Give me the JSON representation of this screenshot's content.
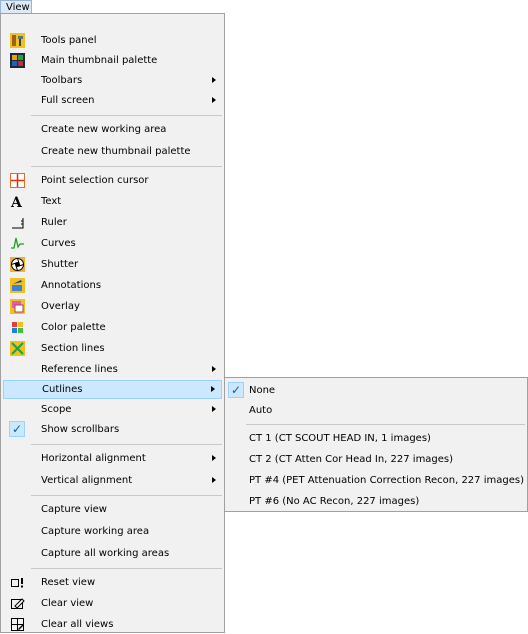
{
  "menubar": {
    "view_label": "View"
  },
  "menu": {
    "tools_panel": "Tools panel",
    "main_thumbnail_palette": "Main thumbnail palette",
    "toolbars": "Toolbars",
    "full_screen": "Full screen",
    "create_working_area": "Create new working area",
    "create_thumbnail_palette": "Create new thumbnail palette",
    "point_selection_cursor": "Point selection cursor",
    "text": "Text",
    "ruler": "Ruler",
    "curves": "Curves",
    "shutter": "Shutter",
    "annotations": "Annotations",
    "overlay": "Overlay",
    "color_palette": "Color palette",
    "section_lines": "Section lines",
    "reference_lines": "Reference lines",
    "cutlines": "Cutlines",
    "scope": "Scope",
    "show_scrollbars": "Show scrollbars",
    "horizontal_alignment": "Horizontal alignment",
    "vertical_alignment": "Vertical alignment",
    "capture_view": "Capture view",
    "capture_working_area": "Capture working area",
    "capture_all_working_areas": "Capture all working areas",
    "reset_view": "Reset view",
    "clear_view": "Clear view",
    "clear_all_views": "Clear all views"
  },
  "cutlines_submenu": {
    "none": "None",
    "auto": "Auto",
    "ct1": "CT 1 (CT SCOUT HEAD IN, 1 images)",
    "ct2": "CT 2 (CT Atten Cor Head In, 227 images)",
    "pt4": "PT #4 (PET Attenuation Correction Recon, 227 images)",
    "pt6": "PT #6 (No AC Recon, 227 images)"
  },
  "checked": {
    "cutlines_none": true,
    "show_scrollbars": true
  },
  "colors": {
    "highlight": "#cce8ff",
    "highlight_border": "#99d1ff",
    "menu_bg": "#f1f1f1"
  }
}
